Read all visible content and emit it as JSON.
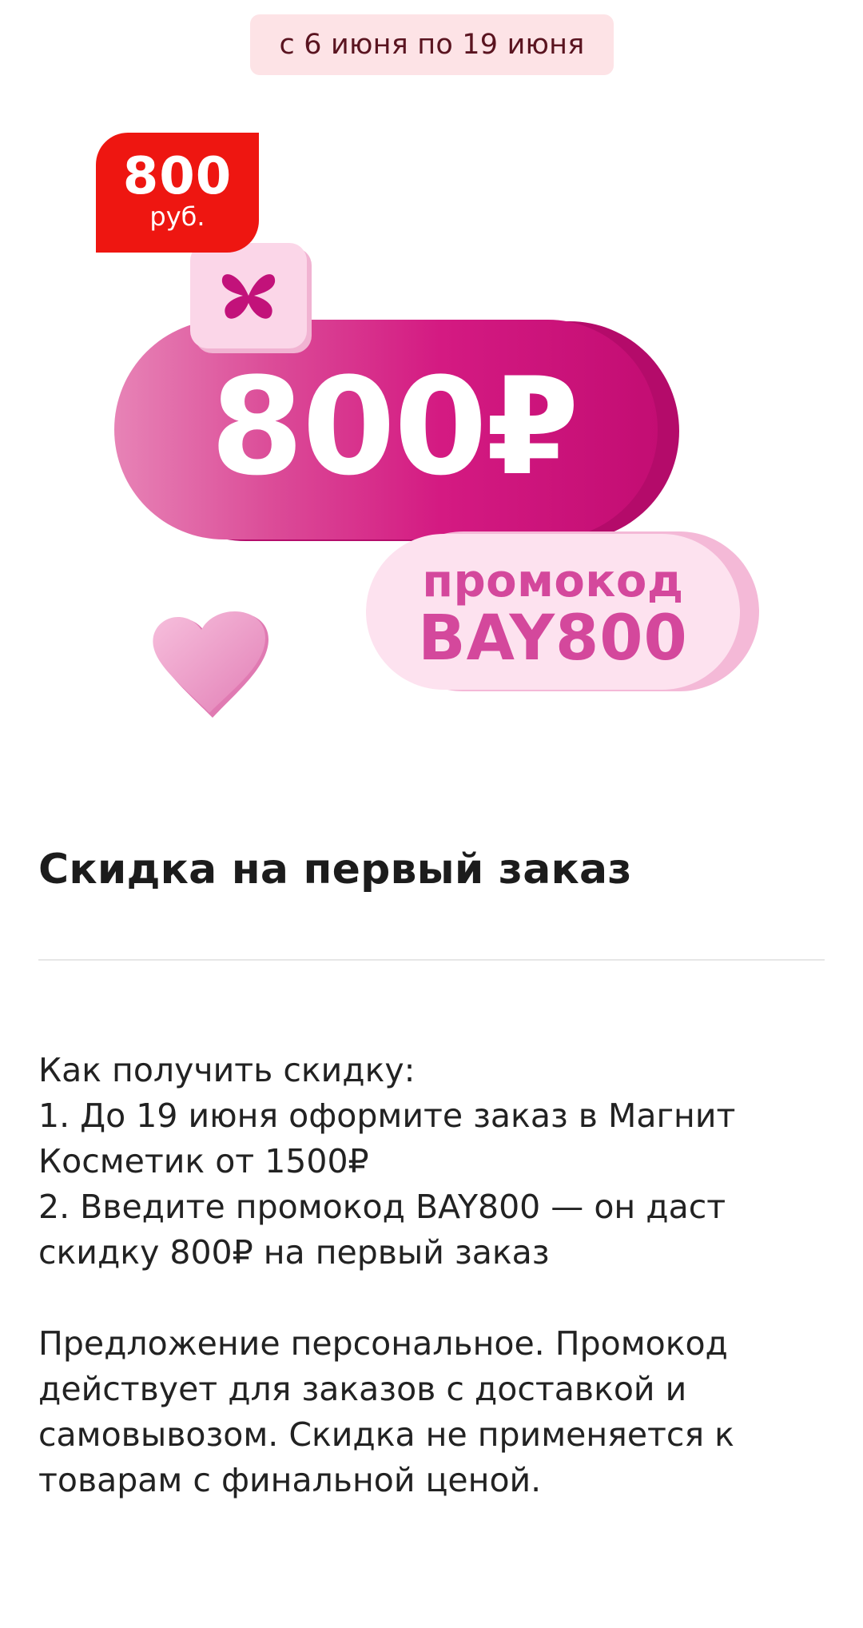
{
  "promo": {
    "date_range": "с 6 июня по 19 июня",
    "badge_amount": "800",
    "badge_unit": "руб.",
    "hero_amount": "800₽",
    "promo_label": "промокод",
    "promo_code": "BAY800"
  },
  "content": {
    "title": "Скидка на первый заказ",
    "instructions": [
      "Как получить скидку:",
      "1. До 19 июня оформите заказ в Магнит",
      "Косметик от 1500₽",
      "2. Введите промокод BAY800 — он даст",
      "скидку 800₽ на первый заказ"
    ],
    "terms": [
      "Предложение персональное. Промокод",
      "действует для заказов с доставкой и",
      "самовывозом. Скидка не применяется к",
      "товарам с финальной ценой."
    ]
  },
  "colors": {
    "badge_red": "#ee1611",
    "brand_pink": "#d41a82",
    "promo_text_pink": "#d4489c",
    "date_pill_bg": "#fde3e6"
  },
  "icons": {
    "logo": "butterfly-logo-icon",
    "heart": "heart-icon"
  }
}
